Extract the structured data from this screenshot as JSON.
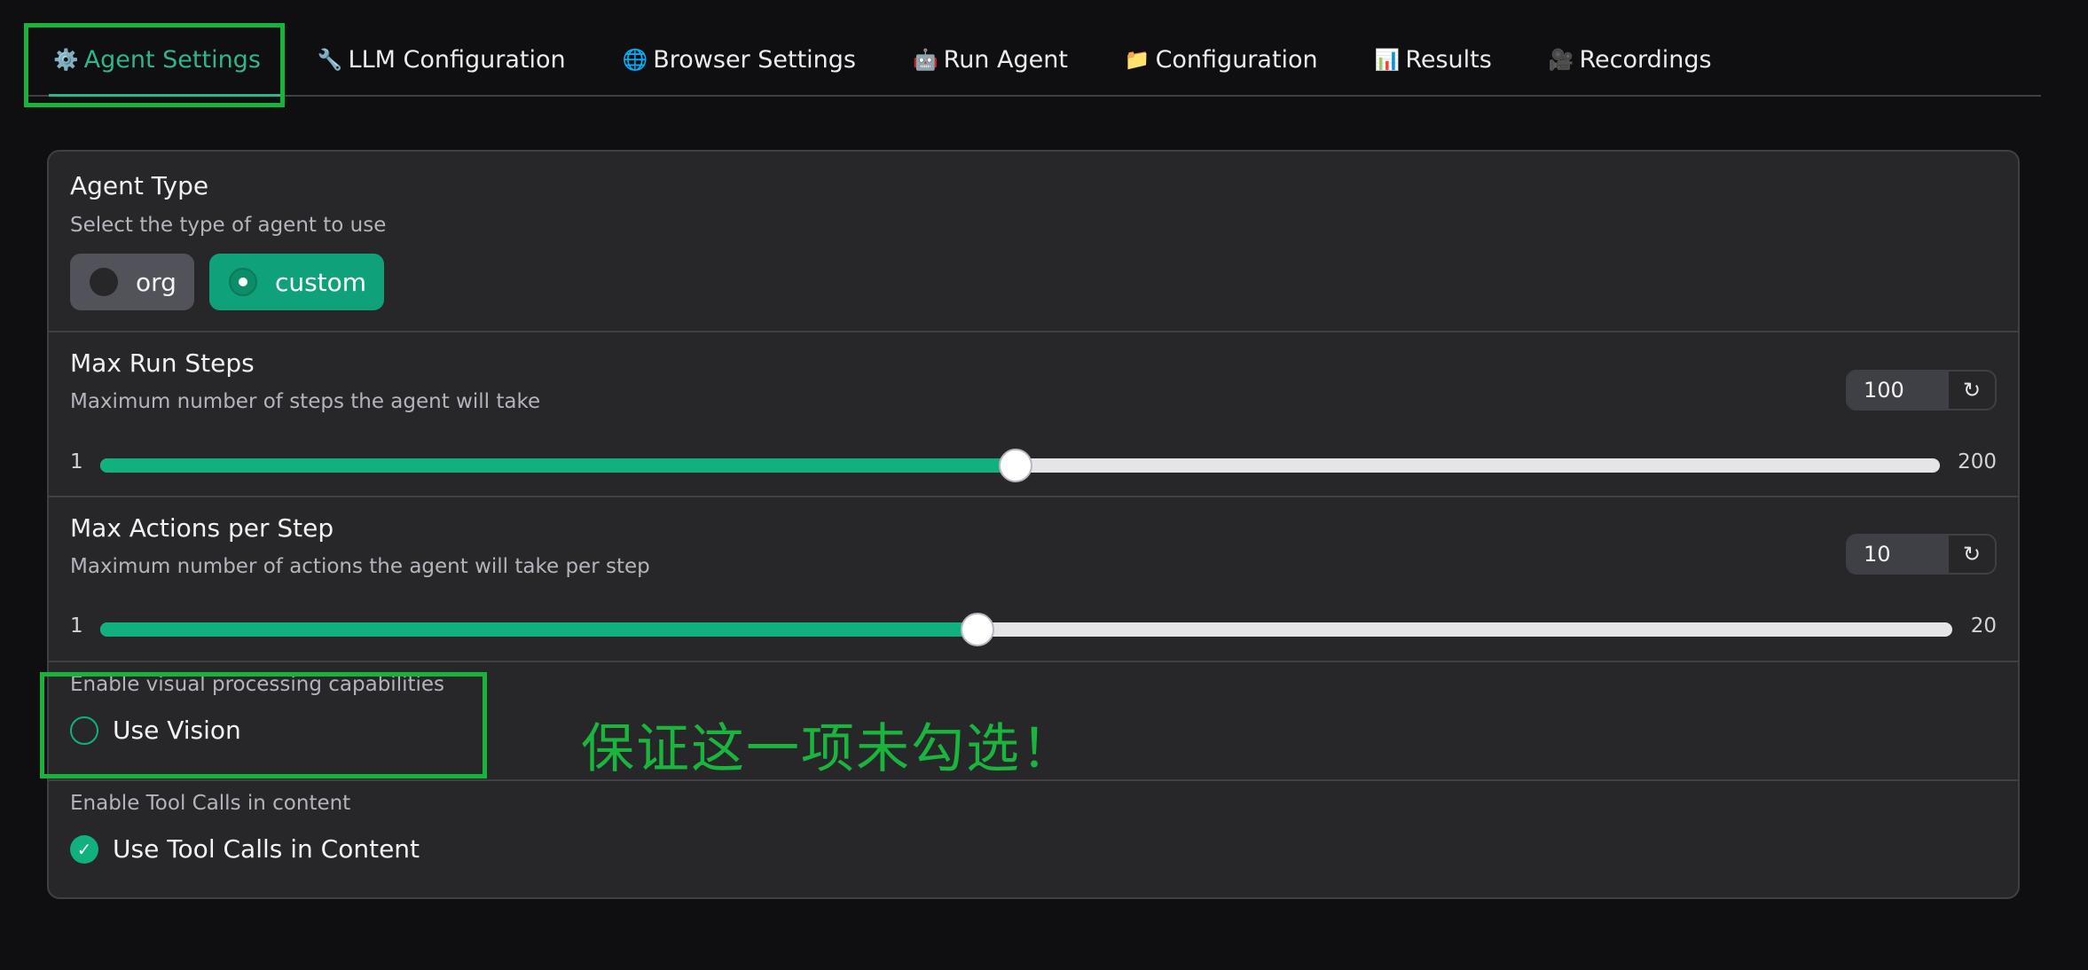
{
  "tabs": [
    {
      "icon": "⚙️",
      "label": "Agent Settings",
      "active": true
    },
    {
      "icon": "🔧",
      "label": "LLM Configuration",
      "active": false
    },
    {
      "icon": "🌐",
      "label": "Browser Settings",
      "active": false
    },
    {
      "icon": "🤖",
      "label": "Run Agent",
      "active": false
    },
    {
      "icon": "📁",
      "label": "Configuration",
      "active": false
    },
    {
      "icon": "📊",
      "label": "Results",
      "active": false
    },
    {
      "icon": "🎥",
      "label": "Recordings",
      "active": false
    }
  ],
  "agent_type": {
    "label": "Agent Type",
    "info": "Select the type of agent to use",
    "options": [
      "org",
      "custom"
    ],
    "selected": "custom"
  },
  "max_run_steps": {
    "label": "Max Run Steps",
    "info": "Maximum number of steps the agent will take",
    "value": "100",
    "min": "1",
    "max": "200",
    "reset_icon": "reset-icon"
  },
  "max_actions_per_step": {
    "label": "Max Actions per Step",
    "info": "Maximum number of actions the agent will take per step",
    "value": "10",
    "min": "1",
    "max": "20",
    "reset_icon": "reset-icon"
  },
  "use_vision": {
    "info": "Enable visual processing capabilities",
    "label": "Use Vision",
    "checked": false
  },
  "tool_calls": {
    "info": "Enable Tool Calls in content",
    "label": "Use Tool Calls in Content",
    "checked": true
  },
  "annotation": {
    "text": "保证这一项未勾选！"
  },
  "colors": {
    "accent": "#10b07f",
    "annotation": "#18b33a",
    "background": "#0f0f11",
    "panel": "#27272a"
  }
}
